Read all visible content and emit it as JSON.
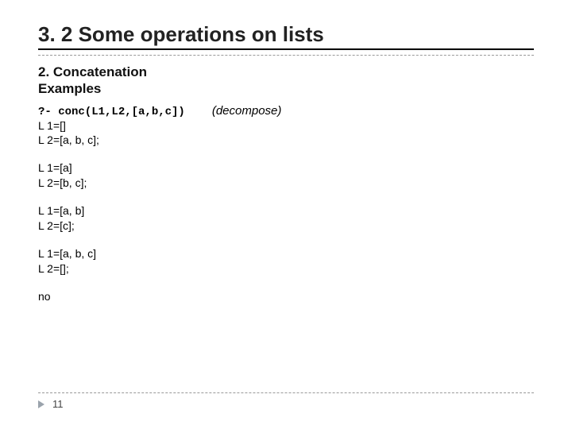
{
  "title": "3. 2 Some operations on lists",
  "subhead_line1": "2.   Concatenation",
  "subhead_line2": "Examples",
  "query": "?- conc(L1,L2,[a,b,c])",
  "annotation": "(decompose)",
  "results": [
    {
      "l1": "L 1=[]",
      "l2": "L 2=[a, b, c];"
    },
    {
      "l1": "L 1=[a]",
      "l2": "L 2=[b, c];"
    },
    {
      "l1": "L 1=[a, b]",
      "l2": "L 2=[c];"
    },
    {
      "l1": "L 1=[a, b, c]",
      "l2": "L 2=[];"
    }
  ],
  "terminal": "no",
  "page_number": "11"
}
